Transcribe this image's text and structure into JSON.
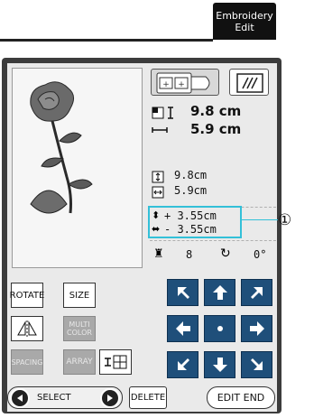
{
  "header": {
    "tab_line1": "Embroidery",
    "tab_line2": "Edit"
  },
  "size": {
    "height": "9.8 cm",
    "width": "5.9 cm"
  },
  "position": {
    "height": "9.8cm",
    "width": "5.9cm",
    "vertical_offset": "+ 3.55cm",
    "horizontal_offset": "- 3.55cm"
  },
  "thread": {
    "count": "8",
    "angle": "0°"
  },
  "callout": {
    "label": "①"
  },
  "buttons": {
    "rotate": "ROTATE",
    "size": "SIZE",
    "multi_color_1": "MULTI",
    "multi_color_2": "COLOR",
    "spacing": "SPACING",
    "array": "ARRAY",
    "select": "SELECT",
    "delete": "DELETE",
    "edit_end": "EDIT END"
  },
  "colors": {
    "pad": "#1f4f7a",
    "highlight": "#33c0d8",
    "panel": "#3c3c3c"
  }
}
